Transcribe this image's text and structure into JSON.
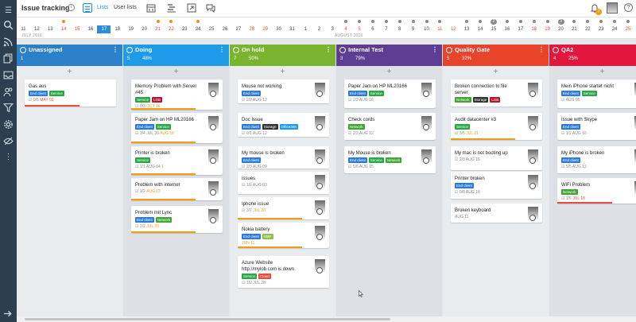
{
  "header": {
    "title": "Issue tracking",
    "tabs": [
      {
        "label": "Lists",
        "active": true
      },
      {
        "label": "User lists",
        "active": false
      }
    ],
    "notification_count": "7"
  },
  "timeline": {
    "days": [
      "11",
      "12",
      "13",
      "14",
      "15",
      "16",
      "17",
      "18",
      "19",
      "20",
      "21",
      "22",
      "23",
      "24",
      "25",
      "26",
      "27",
      "28",
      "29",
      "30",
      "31",
      "1",
      "2",
      "3",
      "4",
      "5",
      "6",
      "7",
      "8",
      "9",
      "10",
      "11",
      "12",
      "13",
      "14",
      "15",
      "16",
      "17",
      "18",
      "19",
      "20",
      "21",
      "22",
      "23",
      "24",
      "25",
      "26",
      "27",
      "28"
    ],
    "weekend_indexes": [
      3,
      4,
      10,
      11,
      17,
      18,
      24,
      25,
      31,
      32,
      38,
      39,
      45,
      46
    ],
    "today_index": 6,
    "badges": [
      {
        "index": 35,
        "text": "2"
      },
      {
        "index": 40,
        "text": "3"
      }
    ],
    "months": [
      "JULY 2016",
      "AUGUST 2016"
    ]
  },
  "columns": [
    {
      "name": "Unassigned",
      "color": "#2c80c9",
      "count": "1",
      "pct": "",
      "cards": [
        {
          "title": "Gas aus",
          "tags": [
            {
              "t": "End client",
              "c": "#2b7bd6"
            },
            {
              "t": "Service",
              "c": "#27a844"
            }
          ],
          "meta": "☑ 0/5",
          "date": "MAY 02",
          "date_class": "red",
          "avatar": false
        }
      ]
    },
    {
      "name": "Doing",
      "color": "#1e9be8",
      "count": "5",
      "pct": "48%",
      "cards": [
        {
          "title": "Memory Problem with Server #45",
          "tags": [
            {
              "t": "Service",
              "c": "#27a844"
            },
            {
              "t": "LGB",
              "c": "#b3162f"
            }
          ],
          "meta": "☑ 0/3",
          "date": "OCT 16",
          "date_class": "orange",
          "avatar": true
        },
        {
          "title": "Paper Jam on HP ML20166",
          "tags": [
            {
              "t": "End client",
              "c": "#2b7bd6"
            },
            {
              "t": "Service",
              "c": "#27a844"
            }
          ],
          "meta": "☑ 3/4  JUL 30",
          "date": "AUG 18",
          "date_class": "orange",
          "avatar": true
        },
        {
          "title": "Printer is broken",
          "tags": [
            {
              "t": "Service",
              "c": "#27a844"
            }
          ],
          "meta": "☑ 1/1  AUG 04",
          "date": "1",
          "date_class": "orange",
          "avatar": true
        },
        {
          "title": "Problem with internet",
          "tags": [],
          "meta": "☑ 1/2",
          "date": "AUG 23",
          "date_class": "orange",
          "avatar": true
        },
        {
          "title": "Problem mit Lync",
          "tags": [
            {
              "t": "End client",
              "c": "#2b7bd6"
            },
            {
              "t": "Network",
              "c": "#3fa535"
            }
          ],
          "meta": "☑ 2/2",
          "date": "JUL 20",
          "date_class": "orange",
          "avatar": true
        }
      ]
    },
    {
      "name": "On hold",
      "color": "#7ab32e",
      "count": "7",
      "pct": "50%",
      "cards": [
        {
          "title": "Mouse not working",
          "tags": [
            {
              "t": "End client",
              "c": "#2b7bd6"
            }
          ],
          "meta": "☑ 2/2  AUG 12",
          "date": "",
          "date_class": "",
          "avatar": true
        },
        {
          "title": "Doc Issue",
          "tags": [
            {
              "t": "End client",
              "c": "#2b7bd6"
            },
            {
              "t": "Storage",
              "c": "#333333"
            },
            {
              "t": "Office365",
              "c": "#1e9be8"
            }
          ],
          "meta": "☑ 0/1  AUG 12",
          "date": "",
          "date_class": "",
          "avatar": true
        },
        {
          "title": "My mouse is broken",
          "tags": [
            {
              "t": "End client",
              "c": "#2b7bd6"
            }
          ],
          "meta": "☑ 2/3  AUG 09",
          "date": "",
          "date_class": "",
          "avatar": true
        },
        {
          "title": "issues",
          "tags": [],
          "meta": "☑ 1/2  AUG 03",
          "date": "",
          "date_class": "",
          "avatar": true
        },
        {
          "title": "Iphone issue",
          "tags": [],
          "meta": "☑ 3/7",
          "date": "JUL 20",
          "date_class": "orange",
          "avatar": true
        },
        {
          "title": "Nokia battery",
          "tags": [
            {
              "t": "End client",
              "c": "#2b7bd6"
            },
            {
              "t": "SMP",
              "c": "#8bc34a"
            }
          ],
          "meta": "",
          "date": "JUN 11",
          "date_class": "orange",
          "avatar": true
        },
        {
          "title": "Azure Website http://mylob.com is down",
          "tags": [
            {
              "t": "Service",
              "c": "#27a844"
            },
            {
              "t": "Cloud",
              "c": "#e74c3c"
            }
          ],
          "meta": "☑ 1/2  JUL 28",
          "date": "",
          "date_class": "",
          "avatar": true
        }
      ]
    },
    {
      "name": "Internal Test",
      "color": "#5c3d92",
      "count": "3",
      "pct": "79%",
      "cards": [
        {
          "title": "Paper Jam on HP ML20166",
          "tags": [
            {
              "t": "End client",
              "c": "#2b7bd6"
            },
            {
              "t": "Service",
              "c": "#27a844"
            }
          ],
          "meta": "☑ 2/3  AUG 16",
          "date": "",
          "date_class": "",
          "avatar": true
        },
        {
          "title": "Check cords",
          "tags": [
            {
              "t": "Network",
              "c": "#3fa535"
            }
          ],
          "meta": "☑ 2/2  AUG 12",
          "date": "",
          "date_class": "",
          "avatar": true
        },
        {
          "title": "My Mouse is broken",
          "tags": [
            {
              "t": "End client",
              "c": "#2b7bd6"
            },
            {
              "t": "Service",
              "c": "#27a844"
            },
            {
              "t": "Network",
              "c": "#3fa535"
            }
          ],
          "meta": "☑ 5/6  AUG 15",
          "date": "",
          "date_class": "",
          "avatar": true
        }
      ]
    },
    {
      "name": "Quality Gate",
      "color": "#e8442b",
      "count": "5",
      "pct": "32%",
      "cards": [
        {
          "title": "Broken connection to file server",
          "tags": [
            {
              "t": "Network",
              "c": "#3fa535"
            },
            {
              "t": "Storage",
              "c": "#333333"
            },
            {
              "t": "LGB",
              "c": "#b3162f"
            }
          ],
          "meta": "",
          "date": "",
          "date_class": "",
          "avatar": true
        },
        {
          "title": "Audit datacenter #3",
          "tags": [
            {
              "t": "Service",
              "c": "#27a844"
            }
          ],
          "meta": "☑ 3/5",
          "date": "JUL 21",
          "date_class": "orange",
          "avatar": true
        },
        {
          "title": "My mac is not booting up",
          "tags": [],
          "meta": "☑ 2/3  AUG 16",
          "date": "",
          "date_class": "",
          "avatar": true
        },
        {
          "title": "Printer broken",
          "tags": [
            {
              "t": "End client",
              "c": "#2b7bd6"
            }
          ],
          "meta": "☑ 0/8  AUG 16",
          "date": "",
          "date_class": "",
          "avatar": true
        },
        {
          "title": "Broken keyboard",
          "tags": [],
          "meta": "AUG 11",
          "date": "",
          "date_class": "",
          "avatar": true
        }
      ]
    },
    {
      "name": "QA2",
      "color": "#e3173e",
      "count": "4",
      "pct": "25%",
      "cards": [
        {
          "title": "Mein iPhone startet nicht",
          "tags": [
            {
              "t": "End client",
              "c": "#2b7bd6"
            },
            {
              "t": "Service",
              "c": "#27a844"
            }
          ],
          "meta": "☑ AUG 05",
          "date": "",
          "date_class": "",
          "avatar": true
        },
        {
          "title": "Issue with Skype",
          "tags": [
            {
              "t": "End client",
              "c": "#2b7bd6"
            }
          ],
          "meta": "☑ 1/2  AUG 16",
          "date": "",
          "date_class": "",
          "avatar": true
        },
        {
          "title": "My iPhone is broken",
          "tags": [
            {
              "t": "End client",
              "c": "#2b7bd6"
            }
          ],
          "meta": "☑ 5/5  AUG 12",
          "date": "",
          "date_class": "",
          "avatar": true
        },
        {
          "title": "WiFi Problem",
          "tags": [
            {
              "t": "Network",
              "c": "#3fa535"
            }
          ],
          "meta": "☑ 1/5",
          "date": "JUL 18",
          "date_class": "red",
          "avatar": true
        }
      ]
    }
  ]
}
